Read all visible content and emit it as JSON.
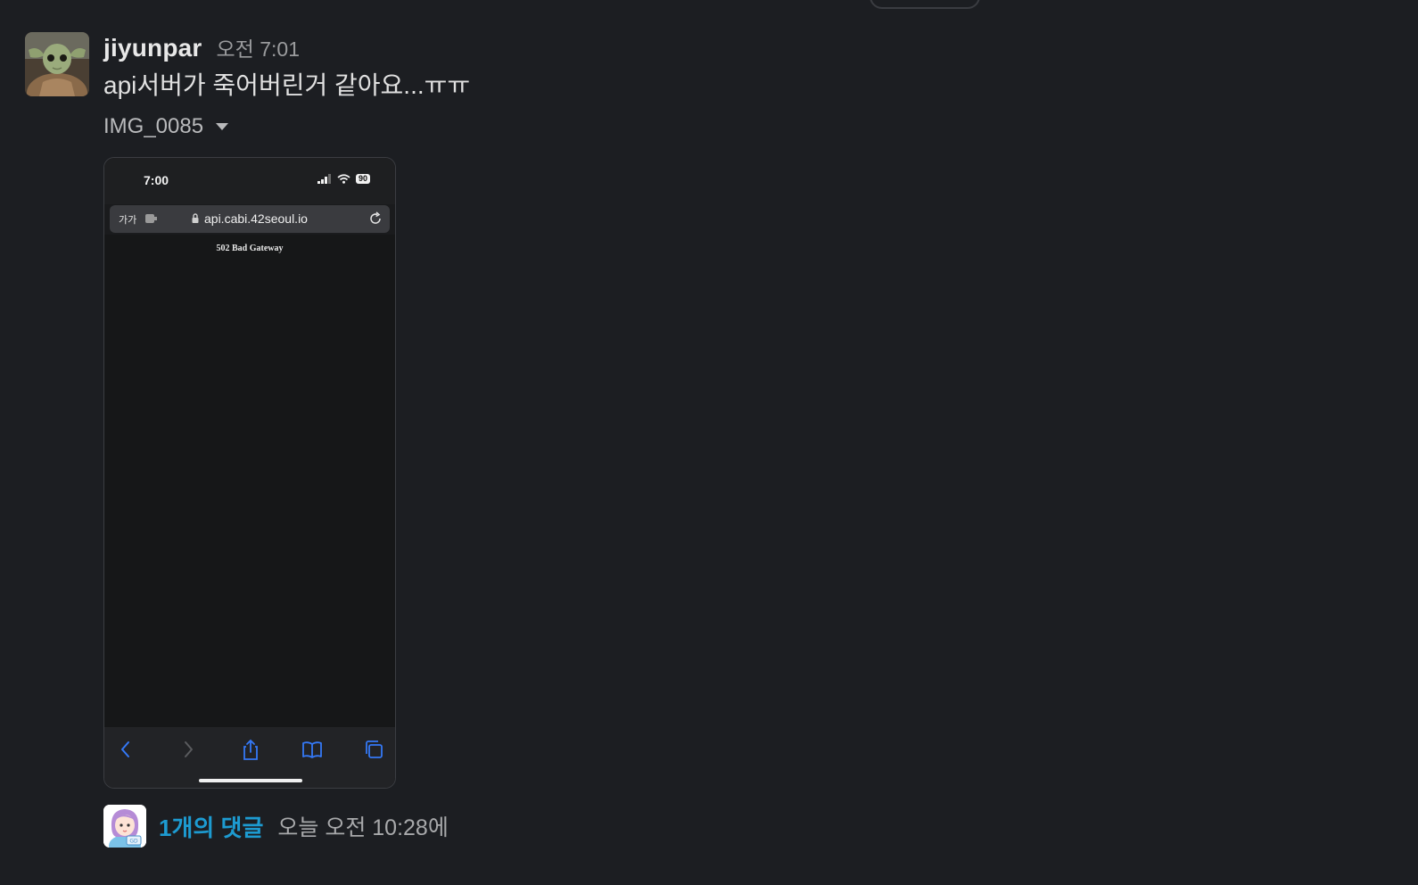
{
  "message": {
    "username": "jiyunpar",
    "time": "오전 7:01",
    "text": "api서버가 죽어버린거 같아요...ㅠㅠ"
  },
  "attachment": {
    "file_name": "IMG_0085",
    "screenshot": {
      "status_time": "7:00",
      "battery": "90",
      "aa_label": "가가",
      "url": "api.cabi.42seoul.io",
      "error_text": "502 Bad Gateway",
      "toolbar_icons": [
        "back-icon",
        "forward-icon",
        "share-icon",
        "bookmarks-icon",
        "tabs-icon"
      ]
    }
  },
  "thread": {
    "reply_count": "1개의 댓글",
    "last_reply": "오늘 오전 10:28에"
  },
  "colors": {
    "background": "#1c1e22",
    "link": "#1d9bd1",
    "ios_blue": "#3478f6"
  }
}
